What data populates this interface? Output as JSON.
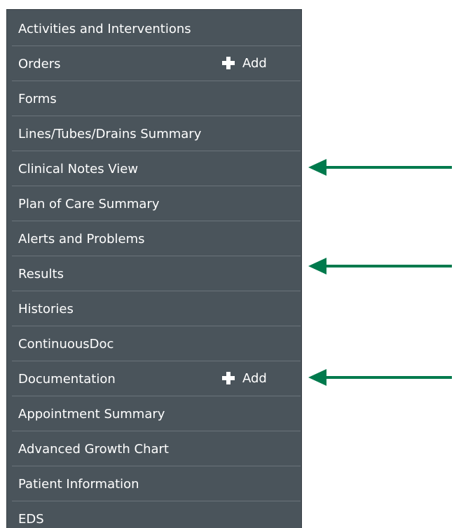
{
  "menu": {
    "items": [
      {
        "label": "Activities and Interventions"
      },
      {
        "label": "Orders",
        "add_label": "Add"
      },
      {
        "label": "Forms"
      },
      {
        "label": "Lines/Tubes/Drains Summary"
      },
      {
        "label": "Clinical Notes View"
      },
      {
        "label": "Plan of Care Summary"
      },
      {
        "label": "Alerts and Problems"
      },
      {
        "label": "Results"
      },
      {
        "label": "Histories"
      },
      {
        "label": "ContinuousDoc"
      },
      {
        "label": "Documentation",
        "add_label": "Add"
      },
      {
        "label": "Appointment Summary"
      },
      {
        "label": "Advanced Growth Chart"
      },
      {
        "label": "Patient Information"
      },
      {
        "label": "EDS"
      }
    ]
  },
  "colors": {
    "menu_background": "#4a545b",
    "divider": "#6b747b",
    "text": "#ffffff",
    "arrow": "#007a4d"
  },
  "icons": {
    "add": "plus-icon",
    "annotation": "arrow-left-icon"
  }
}
